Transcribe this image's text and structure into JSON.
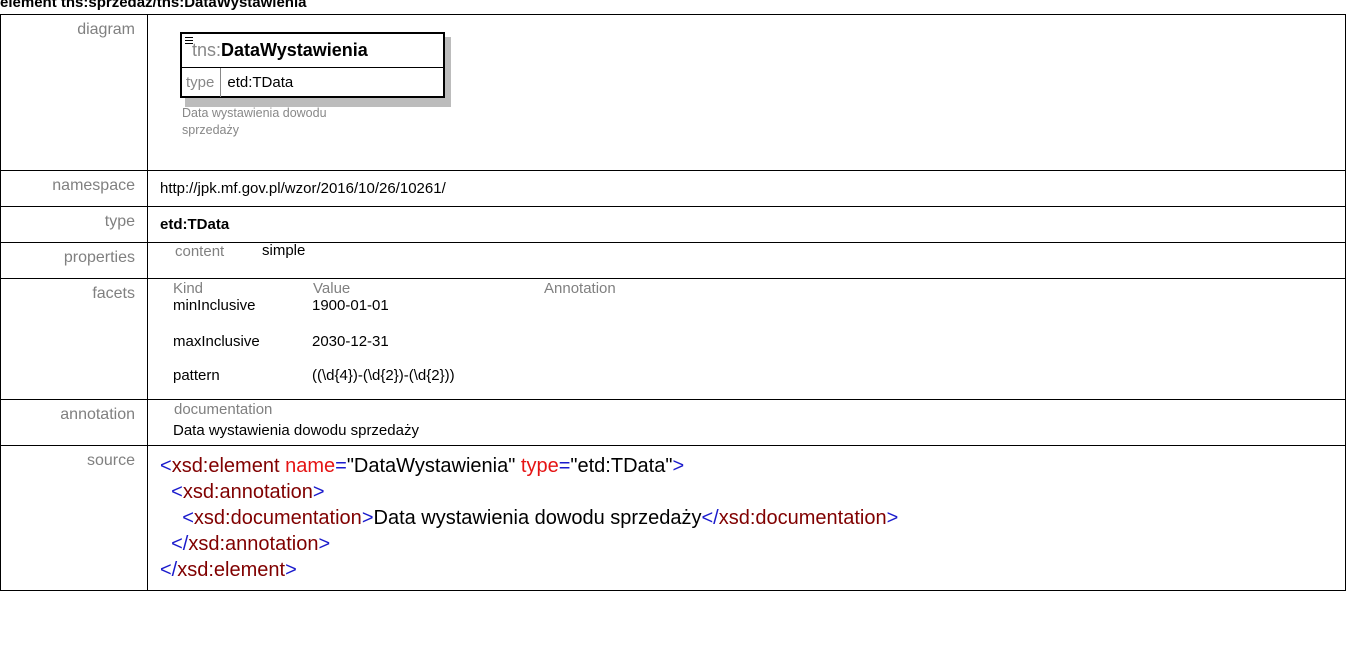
{
  "title": "element tns:sprzedaz/tns:DataWystawienia",
  "labels": {
    "diagram": "diagram",
    "namespace": "namespace",
    "type": "type",
    "properties": "properties",
    "facets": "facets",
    "annotation": "annotation",
    "source": "source"
  },
  "diagram": {
    "prefix": "tns:",
    "name": "DataWystawienia",
    "type_key": "type",
    "type_value": "etd:TData",
    "note": "Data wystawienia dowodu sprzedaży"
  },
  "namespace": "http://jpk.mf.gov.pl/wzor/2016/10/26/10261/",
  "type": "etd:TData",
  "properties": {
    "key": "content",
    "value": "simple"
  },
  "facets": {
    "headers": [
      "Kind",
      "Value",
      "Annotation"
    ],
    "rows": [
      {
        "kind": "minInclusive",
        "value": "1900-01-01"
      },
      {
        "kind": "maxInclusive",
        "value": "2030-12-31"
      },
      {
        "kind": "pattern",
        "value": "((\\d{4})-(\\d{2})-(\\d{2}))"
      }
    ]
  },
  "annotation": {
    "header": "documentation",
    "text": "Data wystawienia dowodu sprzedaży"
  },
  "source": {
    "lines": [
      {
        "indent": "",
        "open": "<",
        "tag": "xsd:element",
        "sp": " ",
        "a1": "name",
        "eq1": "=",
        "v1": "\"DataWystawienia\"",
        "sp2": " ",
        "a2": "type",
        "eq2": "=",
        "v2": "\"etd:TData\"",
        "close": ">"
      },
      {
        "indent": "  ",
        "open": "<",
        "tag": "xsd:annotation",
        "close": ">"
      },
      {
        "indent": "    ",
        "open": "<",
        "tag": "xsd:documentation",
        "close": ">",
        "text": "Data wystawienia dowodu sprzedaży",
        "open2": "</",
        "tag2": "xsd:documentation",
        "close2": ">"
      },
      {
        "indent": "  ",
        "open": "</",
        "tag": "xsd:annotation",
        "close": ">"
      },
      {
        "indent": "",
        "open": "</",
        "tag": "xsd:element",
        "close": ">"
      }
    ]
  }
}
